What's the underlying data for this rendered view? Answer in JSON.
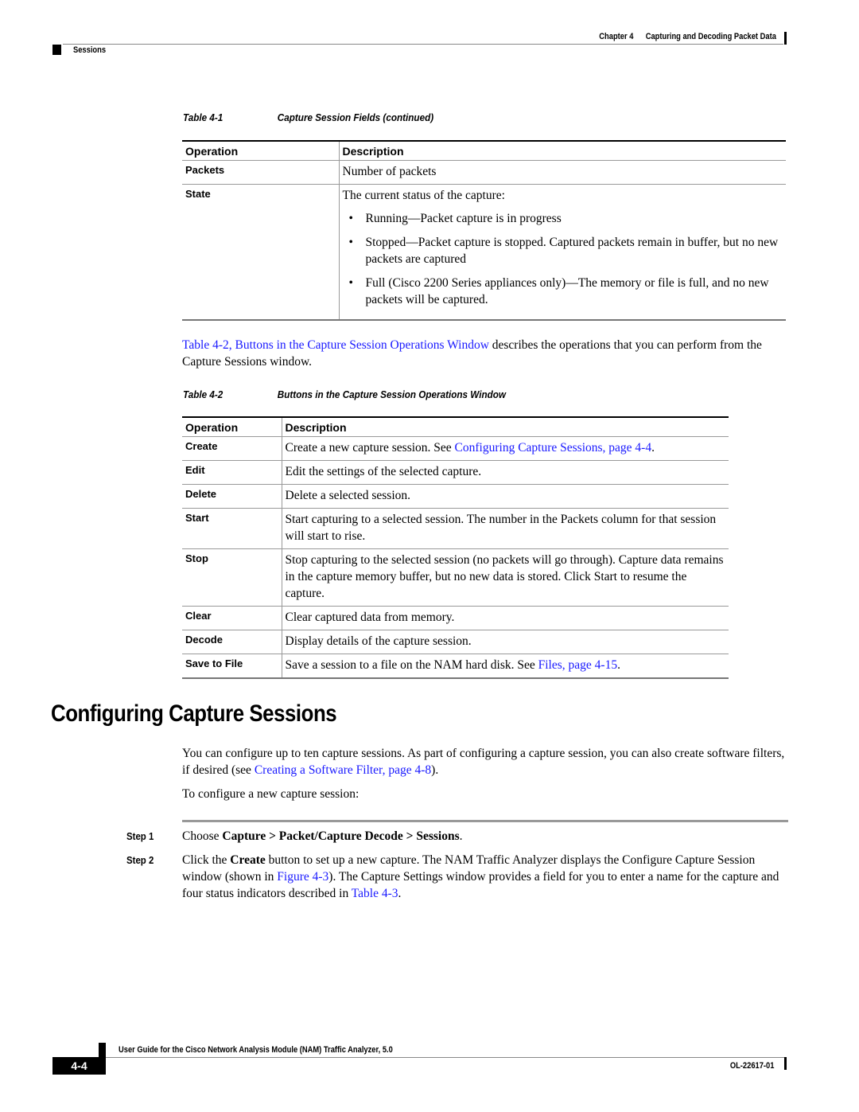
{
  "header": {
    "chapter_label": "Chapter 4",
    "chapter_title": "Capturing and Decoding Packet Data",
    "section": "Sessions"
  },
  "table1": {
    "caption_num": "Table 4-1",
    "caption_title": "Capture Session Fields (continued)",
    "headers": [
      "Operation",
      "Description"
    ],
    "rows": [
      {
        "op": "Packets",
        "desc": "Number of packets"
      },
      {
        "op": "State",
        "desc": "The current status of the capture:",
        "bullets": [
          "Running—Packet capture is in progress",
          "Stopped—Packet capture is stopped. Captured packets remain in buffer, but no new packets are captured",
          "Full (Cisco 2200 Series appliances only)—The memory or file is full, and no new packets will be captured."
        ]
      }
    ]
  },
  "intro_para": {
    "link": "Table 4-2, Buttons in the Capture Session Operations Window",
    "text": " describes the operations that you can perform from the Capture Sessions window."
  },
  "table2": {
    "caption_num": "Table 4-2",
    "caption_title": "Buttons in the Capture Session Operations Window",
    "headers": [
      "Operation",
      "Description"
    ],
    "rows": [
      {
        "op": "Create",
        "desc": "Create a new capture session. See ",
        "link": "Configuring Capture Sessions, page 4-4",
        "after": "."
      },
      {
        "op": "Edit",
        "desc": "Edit the settings of the selected capture."
      },
      {
        "op": "Delete",
        "desc": "Delete a selected session."
      },
      {
        "op": "Start",
        "desc": "Start capturing to a selected session. The number in the Packets column for that session will start to rise."
      },
      {
        "op": "Stop",
        "desc": "Stop capturing to the selected session (no packets will go through). Capture data remains in the capture memory buffer, but no new data is stored. Click Start to resume the capture."
      },
      {
        "op": "Clear",
        "desc": "Clear captured data from memory."
      },
      {
        "op": "Decode",
        "desc": "Display details of the capture session."
      },
      {
        "op": "Save to File",
        "desc": "Save a session to a file on the NAM hard disk. See ",
        "link": "Files, page 4-15",
        "after": "."
      }
    ]
  },
  "section": {
    "heading": "Configuring Capture Sessions",
    "para1_text": "You can configure up to ten capture sessions. As part of configuring a capture session, you can also create software filters, if desired (see ",
    "para1_link": "Creating a Software Filter, page 4-8",
    "para1_after": ").",
    "para2": "To configure a new capture session:"
  },
  "steps": [
    {
      "label": "Step 1",
      "pre": "Choose ",
      "bold": "Capture > Packet/Capture Decode > Sessions",
      "post": "."
    },
    {
      "label": "Step 2",
      "pre": "Click the ",
      "bold": "Create",
      "post": " button to set up a new capture. The NAM Traffic Analyzer displays the Configure Capture Session window (shown in ",
      "link1": "Figure 4-3",
      "post2": "). The Capture Settings window provides a field for you to enter a name for the capture and four status indicators described in ",
      "link2": "Table 4-3",
      "post3": "."
    }
  ],
  "footer": {
    "title": "User Guide for the Cisco Network Analysis Module (NAM) Traffic Analyzer, 5.0",
    "page": "4-4",
    "doc_number": "OL-22617-01"
  }
}
